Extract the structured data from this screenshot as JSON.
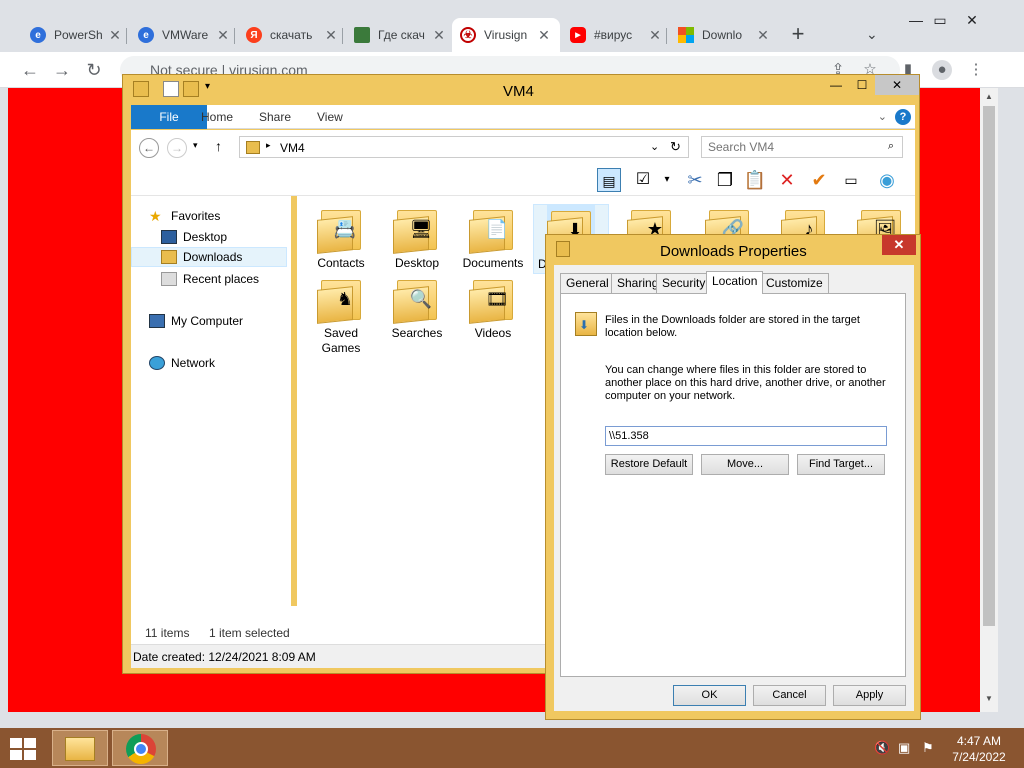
{
  "browser": {
    "tabs": [
      {
        "title": "PowerSh",
        "icon": "edge-logo-icon",
        "color": "#2f6fdb"
      },
      {
        "title": "VMWare",
        "icon": "edge-logo-icon",
        "color": "#2f6fdb"
      },
      {
        "title": "скачать",
        "icon": "yandex-logo-icon",
        "color": "#fc3f1d"
      },
      {
        "title": "Где скач",
        "icon": "image-icon",
        "color": "#3b7a3b"
      },
      {
        "title": "Virusign",
        "icon": "virusign-logo-icon",
        "color": "#c00000"
      },
      {
        "title": "#вирус",
        "icon": "youtube-logo-icon",
        "color": "#ff0000"
      },
      {
        "title": "Downlo",
        "icon": "microsoft-logo-icon",
        "color": "#f25022"
      }
    ],
    "new_tab_label": "+",
    "address_prefix": "Not secure",
    "address_url": "virusign.com"
  },
  "explorer": {
    "title": "VM4",
    "ribbon_tabs": [
      "File",
      "Home",
      "Share",
      "View"
    ],
    "breadcrumb": "VM4",
    "search_placeholder": "Search VM4",
    "nav": {
      "favorites": "Favorites",
      "desktop": "Desktop",
      "downloads": "Downloads",
      "recent": "Recent places",
      "my_computer": "My Computer",
      "network": "Network"
    },
    "files": [
      {
        "label": "Contacts",
        "glyph": "📇"
      },
      {
        "label": "Desktop",
        "glyph": "🖥"
      },
      {
        "label": "Documents",
        "glyph": "📄"
      },
      {
        "label": "D",
        "glyph": "⬇"
      },
      {
        "label": "",
        "glyph": "★"
      },
      {
        "label": "",
        "glyph": "🔗"
      },
      {
        "label": "",
        "glyph": "♪"
      },
      {
        "label": "",
        "glyph": "🖼"
      },
      {
        "label": "Saved Games",
        "glyph": "♞"
      },
      {
        "label": "Searches",
        "glyph": "🔍"
      },
      {
        "label": "Videos",
        "glyph": "🎞"
      }
    ],
    "status_items": "11 items",
    "status_selected": "1 item selected",
    "details": "Date created: 12/24/2021 8:09 AM"
  },
  "properties": {
    "title": "Downloads Properties",
    "tabs": [
      "General",
      "Sharing",
      "Security",
      "Location",
      "Customize"
    ],
    "active_tab": "Location",
    "text1": "Files in the Downloads folder are stored in the target location below.",
    "text2": "You can change where files in this folder are stored to another place on this hard drive, another drive, or another computer on your network.",
    "path_value": "\\\\51.358",
    "restore_label": "Restore Default",
    "move_label": "Move...",
    "find_label": "Find Target...",
    "ok_label": "OK",
    "cancel_label": "Cancel",
    "apply_label": "Apply"
  },
  "taskbar": {
    "time": "4:47 AM",
    "date": "7/24/2022"
  },
  "colors": {
    "page_bg": "#ff0000",
    "window_frame": "#f0c860",
    "accent": "#1979ca"
  }
}
